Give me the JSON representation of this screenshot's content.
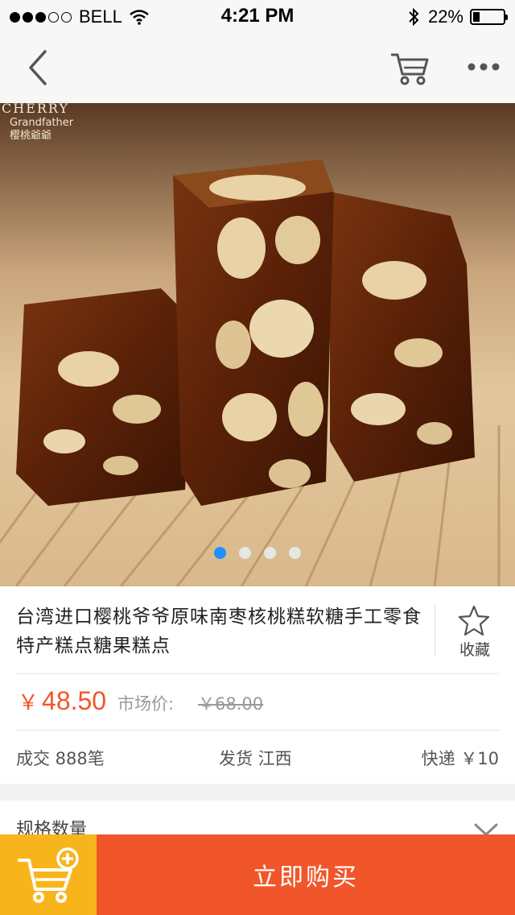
{
  "status": {
    "carrier": "BELL",
    "time": "4:21 PM",
    "battery": "22%",
    "battery_level": 0.22,
    "signal_bars": 3
  },
  "nav": {
    "back_icon": "chevron-left-icon",
    "cart_icon": "cart-icon",
    "more_icon": "more-dots-icon"
  },
  "hero": {
    "brand_text": "CHERRY Grandfather 樱桃爷爷",
    "carousel_count": 4,
    "carousel_active": 0
  },
  "product": {
    "title": "台湾进口樱桃爷爷原味南枣核桃糕软糖手工零食特产糕点糖果糕点",
    "favorite_label": "收藏",
    "price_symbol": "￥",
    "price": "48.50",
    "market_label": "市场价:",
    "market_price": "￥68.00",
    "deals": "成交 888笔",
    "ship_from": "发货 江西",
    "shipping": "快递 ￥10"
  },
  "spec": {
    "label": "规格数量"
  },
  "bottom": {
    "buy_label": "立即购买",
    "add_cart_icon": "cart-plus-icon"
  },
  "colors": {
    "accent": "#f1562a",
    "cart_button": "#f8b51b",
    "carousel_active": "#1e90ff"
  }
}
